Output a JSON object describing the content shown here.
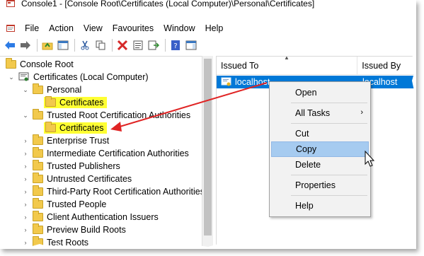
{
  "window": {
    "title": "Console1 - [Console Root\\Certificates (Local Computer)\\Personal\\Certificates]",
    "app_icon": "mmc-console-icon"
  },
  "menubar": {
    "items": [
      "File",
      "Action",
      "View",
      "Favourites",
      "Window",
      "Help"
    ]
  },
  "toolbar": {
    "buttons": [
      "back-icon",
      "forward-icon",
      "up-folder-icon",
      "show-hide-tree-icon",
      "cut-icon",
      "copy-icon",
      "delete-icon",
      "properties-icon",
      "export-list-icon",
      "help-icon",
      "show-action-pane-icon"
    ]
  },
  "tree": {
    "root": "Console Root",
    "certificates": "Certificates (Local Computer)",
    "personal": "Personal",
    "personal_certs": "Certificates",
    "trusted_root": "Trusted Root Certification Authorities",
    "trusted_root_certs": "Certificates",
    "items": [
      "Enterprise Trust",
      "Intermediate Certification Authorities",
      "Trusted Publishers",
      "Untrusted Certificates",
      "Third-Party Root Certification Authorities",
      "Trusted People",
      "Client Authentication Issuers",
      "Preview Build Roots",
      "Test Roots"
    ]
  },
  "list": {
    "columns": [
      "Issued To",
      "Issued By"
    ],
    "rows": [
      {
        "issued_to": "localhost",
        "issued_by": "localhost"
      }
    ]
  },
  "context_menu": {
    "items": [
      "Open",
      "All Tasks",
      "Cut",
      "Copy",
      "Delete",
      "Properties",
      "Help"
    ],
    "active": "Copy"
  },
  "colors": {
    "highlight": "#ffff33",
    "selection": "#0078d7",
    "arrow": "#e02424",
    "menu_active": "#a6cbf0"
  }
}
